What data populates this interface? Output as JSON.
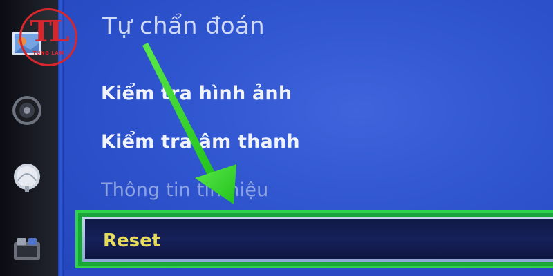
{
  "panel": {
    "title": "Tự chẩn đoán",
    "items": [
      {
        "label": "Kiểm tra hình ảnh"
      },
      {
        "label": "Kiểm tra âm thanh"
      },
      {
        "label": "Thông tin tín hiệu"
      }
    ],
    "selected_item": {
      "label": "Reset"
    }
  },
  "sidebar": {
    "icons": [
      "picture-icon",
      "sound-icon",
      "broadcast-icon",
      "app-icon"
    ]
  },
  "logo": {
    "letters": "TL",
    "subtitle": "TÙNG LÂM"
  },
  "colors": {
    "panel_blue": "#2f55cf",
    "highlight_green": "#2ed34a",
    "selected_text": "#e6dc5a",
    "arrow_green": "#3ddc2f"
  }
}
